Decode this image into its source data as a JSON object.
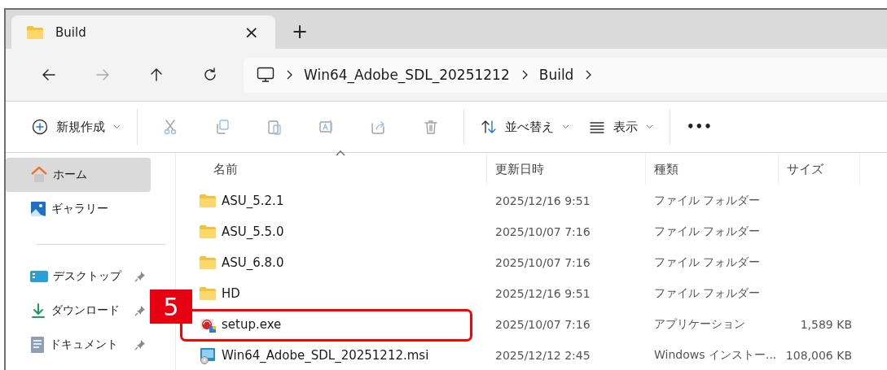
{
  "tab": {
    "title": "Build",
    "close": "×",
    "new_tab": "+"
  },
  "address": {
    "segments": [
      "Win64_Adobe_SDL_20251212",
      "Build"
    ]
  },
  "toolbar": [
    {
      "kind": "new",
      "label": "新規作成",
      "disabled": false
    },
    {
      "kind": "cut",
      "disabled": true
    },
    {
      "kind": "copy",
      "disabled": true
    },
    {
      "kind": "paste",
      "disabled": true
    },
    {
      "kind": "rename",
      "disabled": true
    },
    {
      "kind": "share",
      "disabled": true
    },
    {
      "kind": "delete",
      "disabled": true
    },
    {
      "kind": "sort",
      "label": "並べ替え",
      "disabled": false
    },
    {
      "kind": "view",
      "label": "表示",
      "disabled": false
    },
    {
      "kind": "more",
      "label": "•••",
      "disabled": false
    }
  ],
  "sidebar": {
    "items": [
      {
        "kind": "home",
        "label": "ホーム",
        "selected": true,
        "pinned": false
      },
      {
        "kind": "gallery",
        "label": "ギャラリー",
        "selected": false,
        "pinned": false
      },
      {
        "kind": "divider"
      },
      {
        "kind": "desktop",
        "label": "デスクトップ",
        "selected": false,
        "pinned": true
      },
      {
        "kind": "download",
        "label": "ダウンロード",
        "selected": false,
        "pinned": true
      },
      {
        "kind": "document",
        "label": "ドキュメント",
        "selected": false,
        "pinned": true
      }
    ]
  },
  "table": {
    "columns": [
      "名前",
      "更新日時",
      "種類",
      "サイズ"
    ],
    "rows": [
      {
        "kind": "folder",
        "name": "ASU_5.2.1",
        "modified": "2025/12/16 9:51",
        "type": "ファイル フォルダー"
      },
      {
        "kind": "folder",
        "name": "ASU_5.5.0",
        "modified": "2025/10/07 7:16",
        "type": "ファイル フォルダー"
      },
      {
        "kind": "folder",
        "name": "ASU_6.8.0",
        "modified": "2025/10/07 7:16",
        "type": "ファイル フォルダー"
      },
      {
        "kind": "folder",
        "name": "HD",
        "modified": "2025/12/16 9:51",
        "type": "ファイル フォルダー"
      },
      {
        "kind": "exe",
        "name": "setup.exe",
        "modified": "2025/10/07 7:16",
        "type": "アプリケーション",
        "size": "1,589 KB",
        "callout": "5"
      },
      {
        "kind": "msi",
        "name": "Win64_Adobe_SDL_20251212.msi",
        "modified": "2025/12/12 2:45",
        "type": "Windows インストー...",
        "size": "108,006 KB"
      }
    ]
  }
}
